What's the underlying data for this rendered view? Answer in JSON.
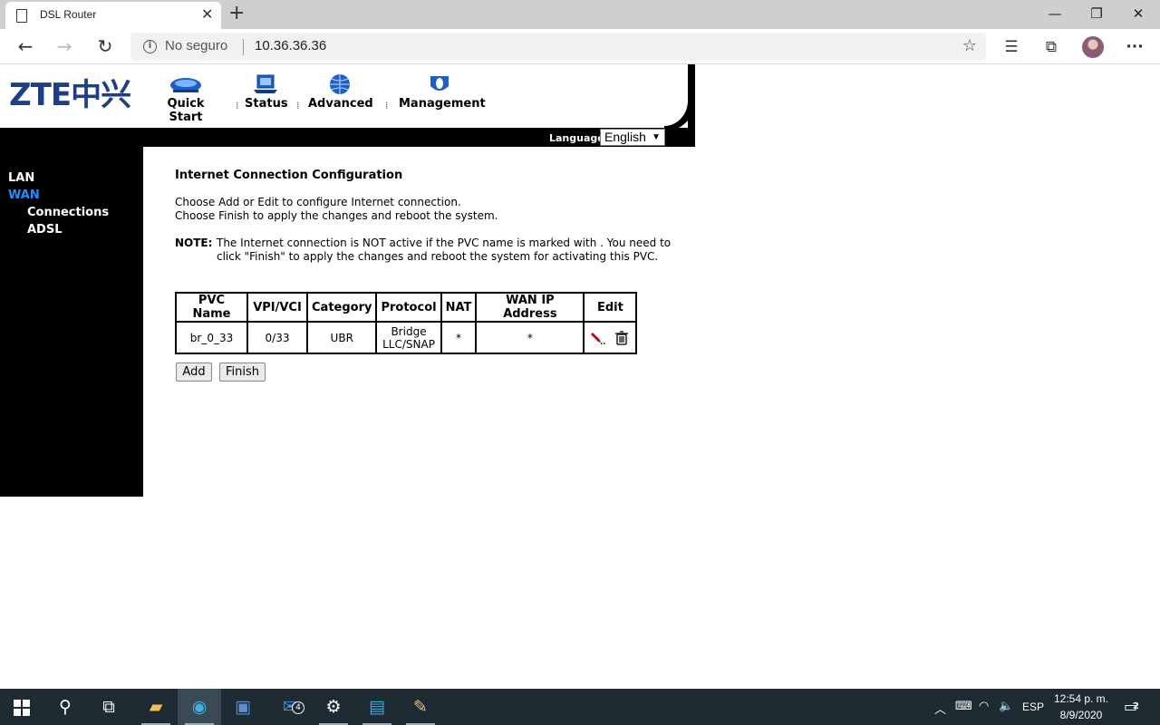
{
  "browser": {
    "tab_title": "DSL Router",
    "security_label": "No seguro",
    "url": "10.36.36.36"
  },
  "router": {
    "logo_text": "ZTE中兴",
    "menu": [
      {
        "label": "Quick Start",
        "icon": "router-icon"
      },
      {
        "label": "Status",
        "icon": "laptop-icon"
      },
      {
        "label": "Advanced",
        "icon": "globe-icon"
      },
      {
        "label": "Management",
        "icon": "shield-icon"
      }
    ],
    "language_label": "Language:",
    "language_value": "English",
    "sidebar": [
      "LAN",
      "WAN",
      "Connections",
      "ADSL"
    ],
    "page_title": "Internet Connection Configuration",
    "desc_line1": "Choose Add or Edit to configure Internet connection.",
    "desc_line2": "Choose Finish to apply the changes and reboot the system.",
    "note_label": "NOTE:",
    "note_text": "The Internet connection is NOT active if the PVC name is marked with . You need to click \"Finish\" to apply the changes and reboot the system for activating this PVC.",
    "table": {
      "headers": [
        "PVC Name",
        "VPI/VCI",
        "Category",
        "Protocol",
        "NAT",
        "WAN IP Address",
        "Edit"
      ],
      "rows": [
        {
          "pvc": "br_0_33",
          "vpivci": "0/33",
          "category": "UBR",
          "protocol_line1": "Bridge",
          "protocol_line2": "LLC/SNAP",
          "nat": "*",
          "wan_ip": "*"
        }
      ]
    },
    "add_label": "Add",
    "finish_label": "Finish"
  },
  "taskbar": {
    "mail_badge": "4",
    "language": "ESP",
    "time": "12:54 p. m.",
    "date": "8/9/2020",
    "notification_count": "2"
  },
  "colors": {
    "accent_blue": "#1e90ff",
    "logo_blue": "#1d3f8a",
    "taskbar": "#1f2b33"
  }
}
